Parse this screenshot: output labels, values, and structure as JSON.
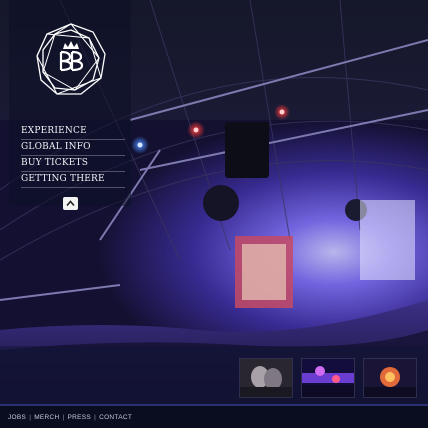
{
  "nav": {
    "items": [
      "EXPERIENCE",
      "GLOBAL INFO",
      "BUY TICKETS",
      "GETTING THERE"
    ]
  },
  "footer": {
    "links": [
      "JOBS",
      "MERCH",
      "PRESS",
      "CONTACT"
    ],
    "separator": "|"
  },
  "icons": {
    "logo": "crown-bb-monogram-logo",
    "collapse": "chevron-up-icon"
  },
  "colors": {
    "stage_blue": "#5b4bd8",
    "stage_purple": "#7a3fc4",
    "light_red": "#ff2a2a",
    "footer_bg": "#0a0c20",
    "menu_text": "#f1f1f4"
  }
}
